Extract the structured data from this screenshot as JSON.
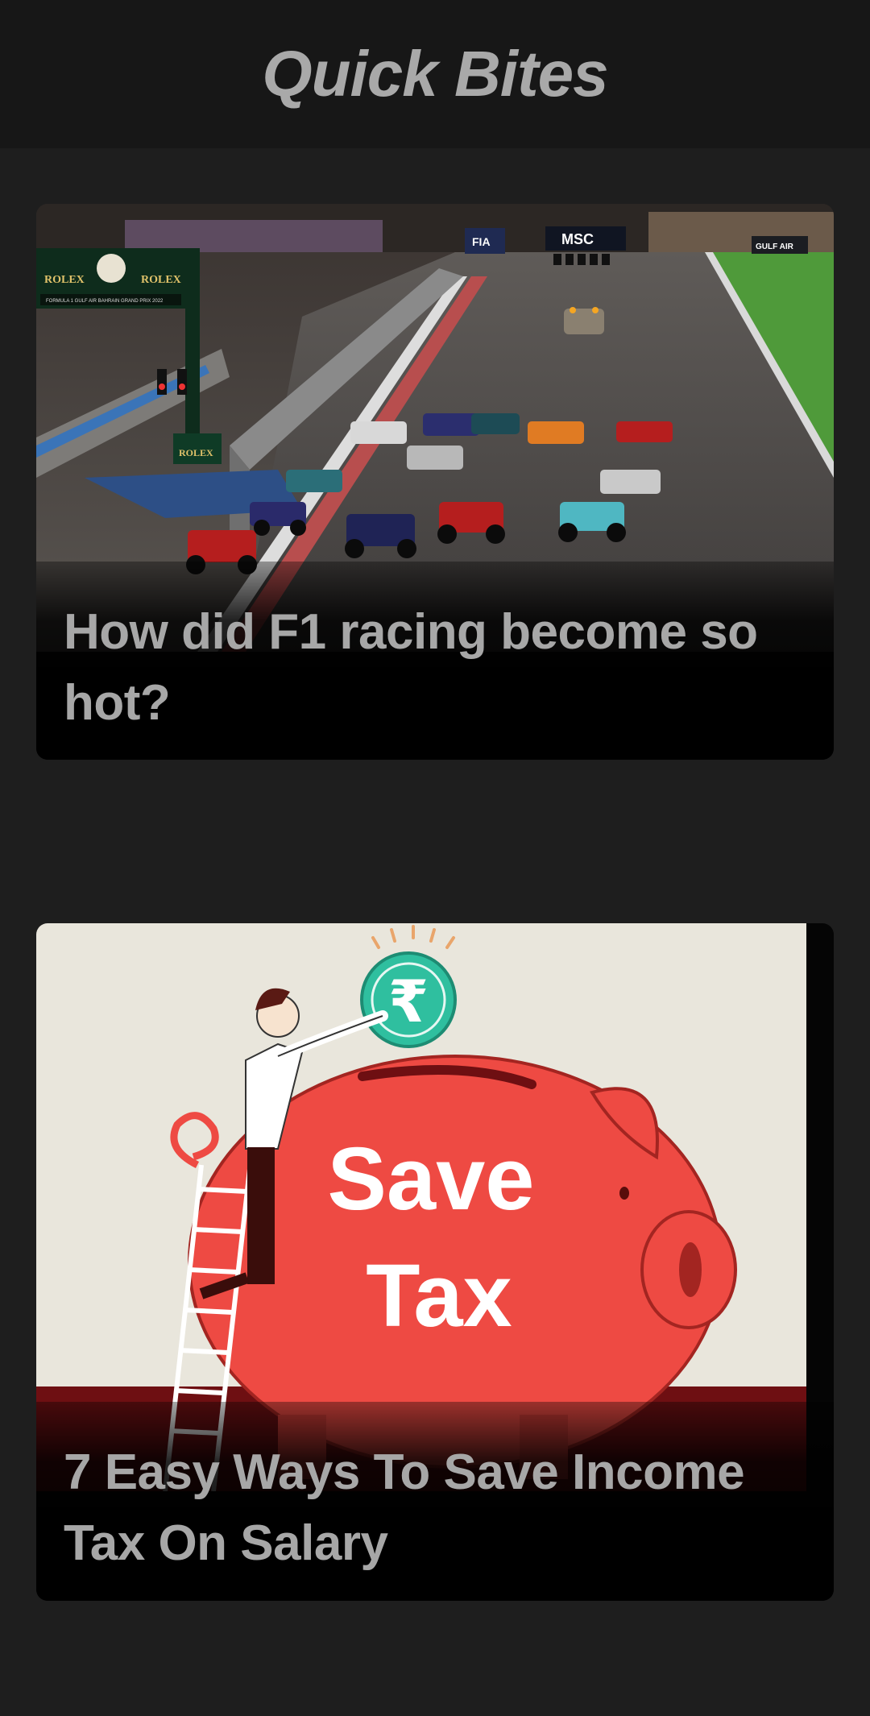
{
  "header": {
    "title": "Quick Bites"
  },
  "cards": [
    {
      "title": "How did F1 racing become so hot?",
      "image_signs": {
        "timing_brand": "ROLEX",
        "timing_brand_2": "ROLEX",
        "gantry_text": "FORMULA 1 GULF AIR BAHRAIN GRAND PRIX 2022",
        "fia": "FIA",
        "sponsor": "MSC",
        "gulf_air": "GULF AIR",
        "pitwall_brand": "ROLEX"
      }
    },
    {
      "title": "7 Easy Ways To Save Income Tax On Salary",
      "image_signs": {
        "line1": "Save",
        "line2": "Tax",
        "currency": "₹"
      }
    }
  ],
  "colors": {
    "background": "#1e1e1e",
    "header_bg": "#171717",
    "title_text": "#a9a9a9",
    "piggy_red": "#ee4a43",
    "coin_teal": "#2fbf9f"
  }
}
